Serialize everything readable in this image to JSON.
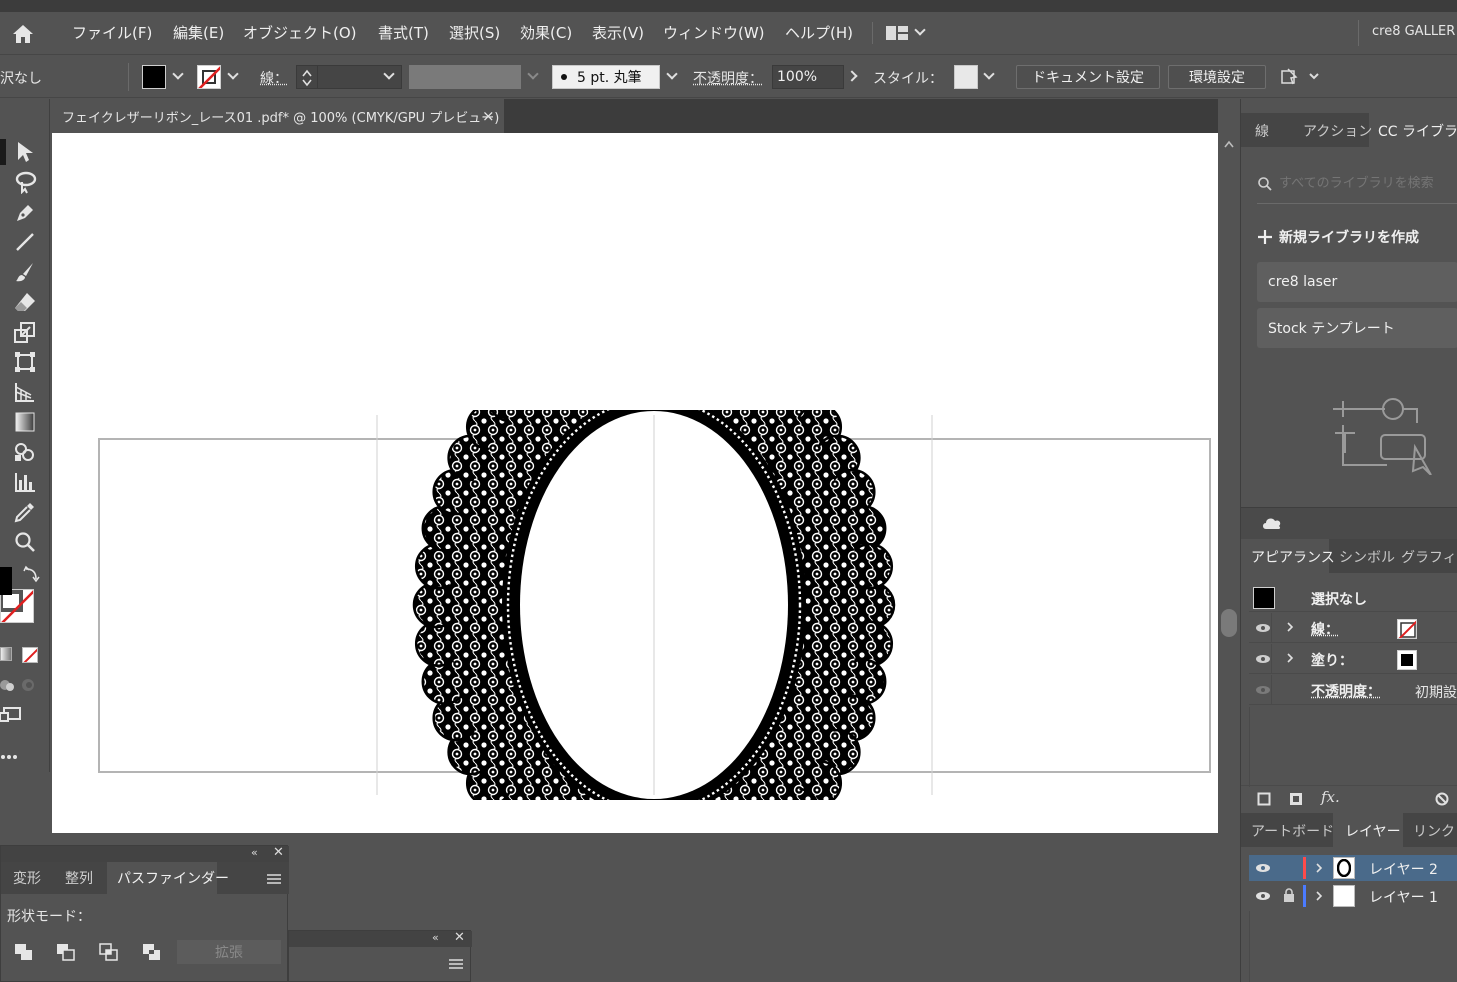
{
  "menubar": {
    "items": [
      "ファイル(F)",
      "編集(E)",
      "オブジェクト(O)",
      "書式(T)",
      "選択(S)",
      "効果(C)",
      "表示(V)",
      "ウィンドウ(W)",
      "ヘルプ(H)"
    ],
    "gallery": "cre8 GALLER"
  },
  "control": {
    "selection": "沢なし",
    "stroke_label": "線：",
    "brush": "5 pt. 丸筆",
    "opacity_label": "不透明度：",
    "opacity_value": "100%",
    "style_label": "スタイル：",
    "doc_settings": "ドキュメント設定",
    "preferences": "環境設定"
  },
  "document": {
    "tab_title": "フェイクレザーリボン_レース01 .pdf* @ 100% (CMYK/GPU プレビュー)",
    "close": "×"
  },
  "pathfinder": {
    "tabs": [
      "変形",
      "整列",
      "パスファインダー"
    ],
    "shape_modes": "形状モード：",
    "expand": "拡張"
  },
  "cc_library": {
    "tabs": [
      "線",
      "アクション",
      "CC ライブラリ"
    ],
    "search_placeholder": "すべてのライブラリを検索",
    "new_library": "新規ライブラリを作成",
    "libraries": [
      "cre8 laser",
      "Stock テンプレート"
    ]
  },
  "appearance": {
    "tabs": [
      "アピアランス",
      "シンボル",
      "グラフィック"
    ],
    "title": "選択なし",
    "stroke": "線：",
    "fill": "塗り：",
    "opacity": "不透明度：",
    "opacity_value": "初期設"
  },
  "layers": {
    "tabs": [
      "アートボード",
      "レイヤー",
      "リンク"
    ],
    "items": [
      {
        "name": "レイヤー 2",
        "color": "#ff4b4b"
      },
      {
        "name": "レイヤー 1",
        "color": "#4b7bff"
      }
    ]
  },
  "colors": {
    "ui_bg": "#535353",
    "dark_bg": "#3c3c3c",
    "selected_layer": "#4a6a8a"
  }
}
